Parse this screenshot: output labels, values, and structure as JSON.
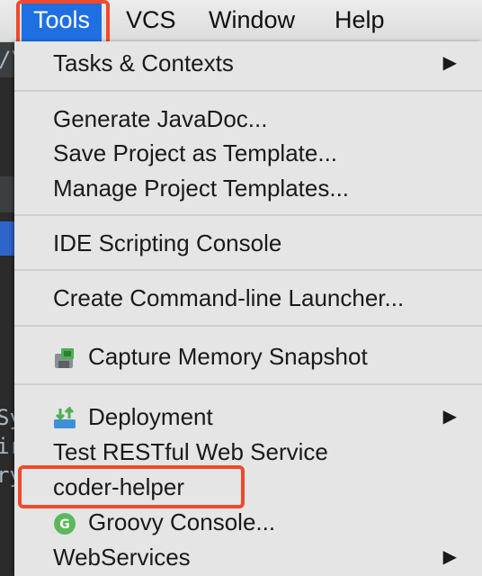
{
  "menubar": {
    "items": [
      {
        "label": "Tools"
      },
      {
        "label": "VCS"
      },
      {
        "label": "Window"
      },
      {
        "label": "Help"
      }
    ]
  },
  "background": {
    "fragments": [
      "/\\",
      "Sy",
      "ir",
      "ry"
    ]
  },
  "menu": {
    "tasks_contexts": "Tasks & Contexts",
    "generate_javadoc": "Generate JavaDoc...",
    "save_project_template": "Save Project as Template...",
    "manage_project_templates": "Manage Project Templates...",
    "ide_scripting_console": "IDE Scripting Console",
    "create_cmdline_launcher": "Create Command-line Launcher...",
    "capture_memory_snapshot": "Capture Memory Snapshot",
    "deployment": "Deployment",
    "test_restful": "Test RESTful Web Service",
    "coder_helper": "coder-helper",
    "groovy_console": "Groovy Console...",
    "webservices": "WebServices",
    "submenu_arrow": "▶"
  },
  "colors": {
    "active_menu": "#1f6fe3",
    "highlight": "#ef4a2c",
    "menu_bg": "#e5e5e5"
  }
}
